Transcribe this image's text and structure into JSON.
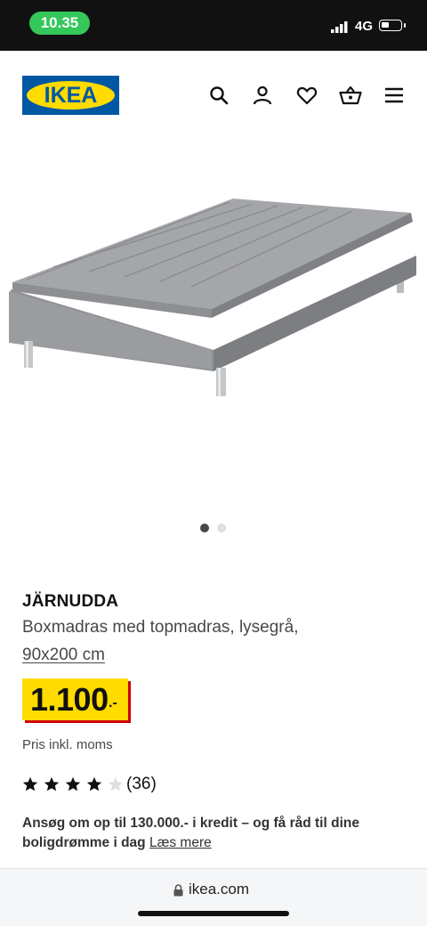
{
  "status_bar": {
    "time": "10.35",
    "network": "4G",
    "battery_level": 0.4
  },
  "header": {
    "logo_text": "IKEA",
    "icons": [
      "search-icon",
      "account-icon",
      "heart-icon",
      "basket-icon",
      "menu-icon"
    ]
  },
  "gallery": {
    "dots": 2,
    "active_index": 0
  },
  "product": {
    "name": "JÄRNUDDA",
    "description": "Boxmadras med topmadras, lysegrå,",
    "size": "90x200 cm",
    "price": "1.100",
    "price_suffix": ".-",
    "vat_note": "Pris inkl. moms",
    "rating": 4,
    "rating_max": 5,
    "review_count": "(36)"
  },
  "credit": {
    "text": "Ansøg om op til 130.000.- i kredit – og få råd til dine boligdrømme i dag",
    "link": "Læs mere"
  },
  "browser": {
    "url": "ikea.com"
  },
  "colors": {
    "ikea_blue": "#0058a3",
    "ikea_yellow": "#ffdb00",
    "price_red": "#cc0008",
    "status_green": "#34c759"
  }
}
